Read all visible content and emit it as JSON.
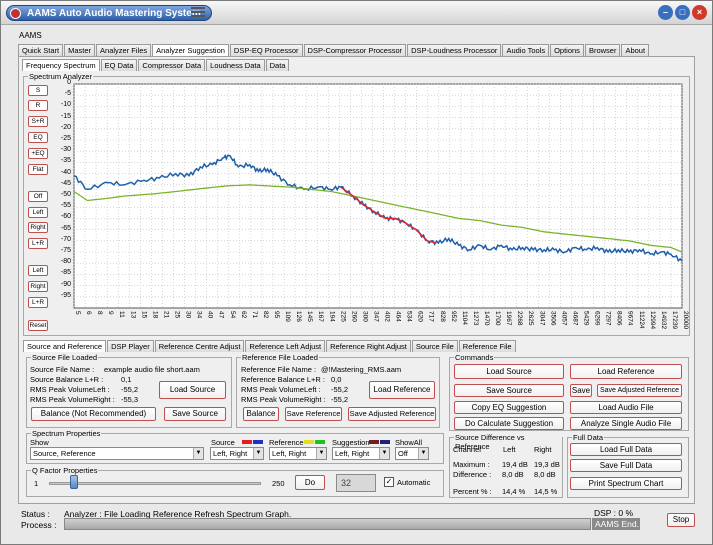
{
  "title": "AAMS Auto Audio Mastering System",
  "section_label": "AAMS",
  "main_tabs": [
    "Quick Start",
    "Master",
    "Analyzer Files",
    "Analyzer Suggestion",
    "DSP-EQ Processor",
    "DSP-Compressor Processor",
    "DSP-Loudness Processor",
    "Audio Tools",
    "Options",
    "Browser",
    "About"
  ],
  "sub_tabs": [
    "Frequency Spectrum",
    "EQ Data",
    "Compressor Data",
    "Loudness Data",
    "Data"
  ],
  "spectrum_title": "Spectrum Analyzer",
  "side_buttons": [
    "S",
    "R",
    "S+R",
    "EQ",
    "+EQ",
    "Flat",
    "Off",
    "Left",
    "Right",
    "L+R",
    "Left",
    "Right",
    "L+R",
    "Reset"
  ],
  "chart_data": {
    "type": "line",
    "xscale": "log",
    "ylim": [
      -100,
      0
    ],
    "y_ticks": [
      0,
      -5,
      -10,
      -15,
      -20,
      -25,
      -30,
      -35,
      -40,
      -45,
      -50,
      -55,
      -60,
      -65,
      -70,
      -75,
      -80,
      -85,
      -90,
      -95
    ],
    "x_ticks": [
      "5",
      "6",
      "8",
      "9",
      "11",
      "13",
      "15",
      "18",
      "21",
      "25",
      "30",
      "34",
      "40",
      "47",
      "54",
      "62",
      "71",
      "82",
      "95",
      "109",
      "126",
      "145",
      "167",
      "194",
      "225",
      "260",
      "300",
      "347",
      "402",
      "464",
      "534",
      "620",
      "717",
      "828",
      "952",
      "1104",
      "1273",
      "1470",
      "1700",
      "1967",
      "2268",
      "2625",
      "3047",
      "3506",
      "4057",
      "4687",
      "5429",
      "6299",
      "7297",
      "8406",
      "9674",
      "11224",
      "12994",
      "14932",
      "17239",
      "20000"
    ],
    "series": [
      {
        "color": "#1f5fa8",
        "points": [
          [
            5,
            -41
          ],
          [
            6,
            -47
          ],
          [
            8,
            -44
          ],
          [
            10,
            -45
          ],
          [
            13,
            -43
          ],
          [
            16,
            -42
          ],
          [
            20,
            -40
          ],
          [
            24,
            -41
          ],
          [
            28,
            -37
          ],
          [
            33,
            -36
          ],
          [
            38,
            -33
          ],
          [
            42,
            -32
          ],
          [
            47,
            -37
          ],
          [
            55,
            -36
          ],
          [
            62,
            -39
          ],
          [
            70,
            -38
          ],
          [
            80,
            -41
          ],
          [
            95,
            -45
          ],
          [
            115,
            -47
          ],
          [
            140,
            -46
          ],
          [
            165,
            -47
          ],
          [
            190,
            -46
          ],
          [
            225,
            -50
          ],
          [
            260,
            -54
          ],
          [
            300,
            -57
          ],
          [
            350,
            -60
          ],
          [
            400,
            -60
          ],
          [
            460,
            -62
          ],
          [
            530,
            -65
          ],
          [
            620,
            -70
          ],
          [
            720,
            -71
          ],
          [
            830,
            -69
          ],
          [
            950,
            -72
          ],
          [
            1100,
            -74
          ],
          [
            1270,
            -72
          ],
          [
            1470,
            -74
          ],
          [
            1700,
            -72
          ],
          [
            1970,
            -74
          ],
          [
            2270,
            -73
          ],
          [
            2630,
            -74
          ],
          [
            3050,
            -74
          ],
          [
            3500,
            -74
          ],
          [
            4060,
            -75
          ],
          [
            4690,
            -73
          ],
          [
            5430,
            -74
          ],
          [
            6300,
            -73
          ],
          [
            7300,
            -75
          ],
          [
            8400,
            -74
          ],
          [
            9700,
            -75
          ],
          [
            11200,
            -74
          ],
          [
            13000,
            -76
          ],
          [
            15000,
            -75
          ],
          [
            17200,
            -76
          ],
          [
            20000,
            -79
          ]
        ]
      },
      {
        "color": "#7ab42c",
        "points": [
          [
            5,
            -48
          ],
          [
            6,
            -52
          ],
          [
            8,
            -51
          ],
          [
            10,
            -50
          ],
          [
            15,
            -49
          ],
          [
            20,
            -48
          ],
          [
            30,
            -46.5
          ],
          [
            40,
            -45.5
          ],
          [
            55,
            -45
          ],
          [
            70,
            -45.5
          ],
          [
            95,
            -46
          ],
          [
            126,
            -47
          ],
          [
            167,
            -48
          ],
          [
            225,
            -50
          ],
          [
            300,
            -52
          ],
          [
            400,
            -54
          ],
          [
            534,
            -56
          ],
          [
            717,
            -58
          ],
          [
            952,
            -60
          ],
          [
            1273,
            -61
          ],
          [
            1700,
            -63
          ],
          [
            2268,
            -64
          ],
          [
            3047,
            -66
          ],
          [
            4057,
            -67
          ],
          [
            5429,
            -68
          ],
          [
            7297,
            -69
          ],
          [
            9674,
            -70
          ],
          [
            12994,
            -72
          ],
          [
            17239,
            -73
          ],
          [
            20000,
            -75
          ]
        ]
      },
      {
        "color": "#e0282c",
        "points": [
          [
            190,
            -46
          ],
          [
            225,
            -50
          ],
          [
            260,
            -54
          ],
          [
            300,
            -57
          ],
          [
            350,
            -60
          ],
          [
            400,
            -60
          ],
          [
            460,
            -62
          ],
          [
            530,
            -65
          ],
          [
            620,
            -70
          ],
          [
            700,
            -71
          ]
        ]
      }
    ]
  },
  "sub_panel_tabs": [
    "Source and Reference",
    "DSP Player",
    "Reference Centre Adjust",
    "Reference Left Adjust",
    "Reference Right Adjust",
    "Source File",
    "Reference File"
  ],
  "source_file": {
    "group": "Source File Loaded",
    "name_label": "Source File Name :",
    "name_value": "example audio file short.aam",
    "balance_label": "Source Balance L+R :",
    "balance_value": "0,1",
    "rms_label1": "RMS Peak Volume",
    "left_label": "Left :",
    "left_value": "-55,2",
    "rms_label2": "RMS Peak Volume",
    "right_label": "Right :",
    "right_value": "-55,3",
    "load_button": "Load Source",
    "balance_button": "Balance (Not Recommended)",
    "save_button": "Save Source"
  },
  "reference_file": {
    "group": "Reference File Loaded",
    "name_label": "Reference File Name :",
    "name_value": "@!Mastering_RMS.aam",
    "balance_label": "Reference  Balance L+R :",
    "balance_value": "0,0",
    "rms_label1": "RMS Peak Volume",
    "left_label": "Left :",
    "left_value": "-55,2",
    "rms_label2": "RMS Peak Volume",
    "right_label": "Right :",
    "right_value": "-55,2",
    "load_button": "Load Reference",
    "balance_button": "Balance",
    "save_button": "Save Reference",
    "save_adjusted_button": "Save Adjusted Reference"
  },
  "commands": {
    "group": "Commands",
    "load_source": "Load Source",
    "load_reference": "Load Reference",
    "save_source": "Save Source",
    "save": "Save",
    "save_adjusted_reference": "Save Adjusted Reference",
    "copy_eq": "Copy EQ Suggestion",
    "load_audio": "Load Audio File",
    "do_calc": "Do Calculate Suggestion",
    "analyze_single": "Analyze Single Audio File"
  },
  "spectrum_properties": {
    "group": "Spectrum Properties",
    "show_label": "Show",
    "show_value": "Source, Reference",
    "source_label": "Source",
    "source_value": "Left, Right",
    "reference_label": "Reference",
    "reference_value": "Left, Right",
    "suggestion_label": "Suggestion",
    "suggestion_value": "Left, Right",
    "showall_label": "ShowAll",
    "showall_value": "Off",
    "source_colors": [
      "#e02020",
      "#2030c0"
    ],
    "reference_colors": [
      "#e0e020",
      "#20c020"
    ],
    "suggestion_colors": [
      "#702020",
      "#202080"
    ]
  },
  "q_factor": {
    "group": "Q Factor Properties",
    "min": "1",
    "max": "250",
    "level": 0.12,
    "do_button": "Do",
    "value": "32",
    "automatic_label": "Automatic",
    "automatic_checked": "✓"
  },
  "source_difference": {
    "group": "Source Difference vs Reference",
    "channel_label": "Channel",
    "left_label": "Left",
    "right_label": "Right",
    "max_label": "Maximum :",
    "max_left": "19,4 dB",
    "max_right": "19,3 dB",
    "diff_label": "Difference :",
    "diff_left": "8,0 dB",
    "diff_right": "8,0 dB",
    "pct_label": "Percent % :",
    "pct_left": "14,4 %",
    "pct_right": "14,5 %"
  },
  "full_data": {
    "group": "Full Data",
    "load": "Load Full Data",
    "save": "Save Full Data",
    "print": "Print Spectrum Chart"
  },
  "status": {
    "status_label": "Status :",
    "status_text": "Analyzer : File Loading Reference Refresh Spectrum Graph.",
    "process_label": "Process :",
    "dsp_text": "DSP :  0 %",
    "end_text": "AAMS End.",
    "stop_button": "Stop"
  }
}
